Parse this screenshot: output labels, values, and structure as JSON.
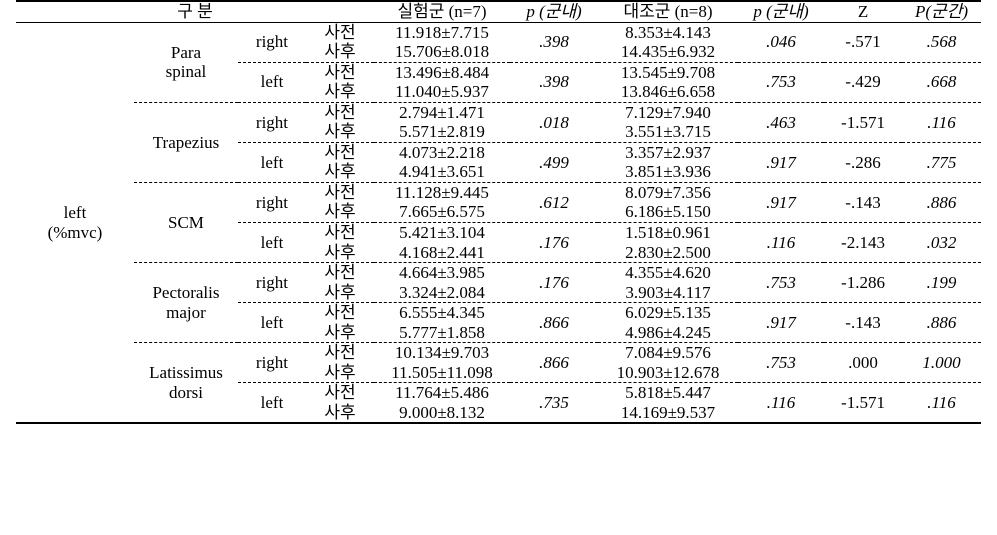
{
  "table": {
    "row_label": "left\n(%mvc)",
    "row_label_line1": "left",
    "row_label_line2": "(%mvc)",
    "headers": {
      "category": "구 분",
      "experimental": "실험군 (n=7)",
      "p_within_exp": "p (군내)",
      "control": "대조군 (n=8)",
      "p_within_ctl": "p (군내)",
      "z": "Z",
      "p_between": "P(군간)"
    },
    "time_labels": {
      "pre": "사전",
      "post": "사후"
    },
    "side_labels": {
      "right": "right",
      "left": "left"
    },
    "muscles": [
      {
        "name_line1": "Para",
        "name_line2": "spinal",
        "sides": [
          {
            "side": "right",
            "exp_pre": "11.918±7.715",
            "exp_post": "15.706±8.018",
            "p_exp": ".398",
            "ctl_pre": "8.353±4.143",
            "ctl_post": "14.435±6.932",
            "p_ctl": ".046",
            "z": "-.571",
            "p_between": ".568"
          },
          {
            "side": "left",
            "exp_pre": "13.496±8.484",
            "exp_post": "11.040±5.937",
            "p_exp": ".398",
            "ctl_pre": "13.545±9.708",
            "ctl_post": "13.846±6.658",
            "p_ctl": ".753",
            "z": "-.429",
            "p_between": ".668"
          }
        ]
      },
      {
        "name_line1": "Trapezius",
        "name_line2": "",
        "sides": [
          {
            "side": "right",
            "exp_pre": "2.794±1.471",
            "exp_post": "5.571±2.819",
            "p_exp": ".018",
            "ctl_pre": "7.129±7.940",
            "ctl_post": "3.551±3.715",
            "p_ctl": ".463",
            "z": "-1.571",
            "p_between": ".116"
          },
          {
            "side": "left",
            "exp_pre": "4.073±2.218",
            "exp_post": "4.941±3.651",
            "p_exp": ".499",
            "ctl_pre": "3.357±2.937",
            "ctl_post": "3.851±3.936",
            "p_ctl": ".917",
            "z": "-.286",
            "p_between": ".775"
          }
        ]
      },
      {
        "name_line1": "SCM",
        "name_line2": "",
        "sides": [
          {
            "side": "right",
            "exp_pre": "11.128±9.445",
            "exp_post": "7.665±6.575",
            "p_exp": ".612",
            "ctl_pre": "8.079±7.356",
            "ctl_post": "6.186±5.150",
            "p_ctl": ".917",
            "z": "-.143",
            "p_between": ".886"
          },
          {
            "side": "left",
            "exp_pre": "5.421±3.104",
            "exp_post": "4.168±2.441",
            "p_exp": ".176",
            "ctl_pre": "1.518±0.961",
            "ctl_post": "2.830±2.500",
            "p_ctl": ".116",
            "z": "-2.143",
            "p_between": ".032"
          }
        ]
      },
      {
        "name_line1": "Pectoralis",
        "name_line2": "major",
        "sides": [
          {
            "side": "right",
            "exp_pre": "4.664±3.985",
            "exp_post": "3.324±2.084",
            "p_exp": ".176",
            "ctl_pre": "4.355±4.620",
            "ctl_post": "3.903±4.117",
            "p_ctl": ".753",
            "z": "-1.286",
            "p_between": ".199"
          },
          {
            "side": "left",
            "exp_pre": "6.555±4.345",
            "exp_post": "5.777±1.858",
            "p_exp": ".866",
            "ctl_pre": "6.029±5.135",
            "ctl_post": "4.986±4.245",
            "p_ctl": ".917",
            "z": "-.143",
            "p_between": ".886"
          }
        ]
      },
      {
        "name_line1": "Latissimus",
        "name_line2": "dorsi",
        "sides": [
          {
            "side": "right",
            "exp_pre": "10.134±9.703",
            "exp_post": "11.505±11.098",
            "p_exp": ".866",
            "ctl_pre": "7.084±9.576",
            "ctl_post": "10.903±12.678",
            "p_ctl": ".753",
            "z": ".000",
            "p_between": "1.000"
          },
          {
            "side": "left",
            "exp_pre": "11.764±5.486",
            "exp_post": "9.000±8.132",
            "p_exp": ".735",
            "ctl_pre": "5.818±5.447",
            "ctl_post": "14.169±9.537",
            "p_ctl": ".116",
            "z": "-1.571",
            "p_between": ".116"
          }
        ]
      }
    ]
  }
}
